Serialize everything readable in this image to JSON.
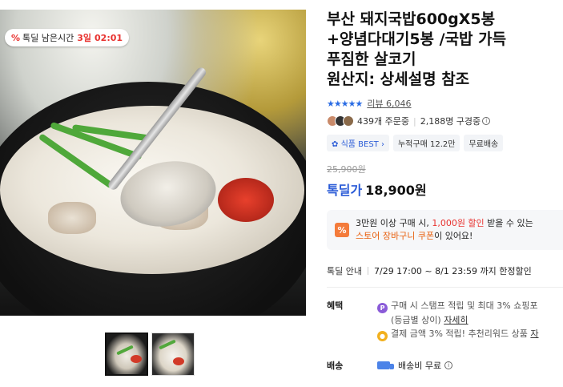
{
  "badge": {
    "icon": "%",
    "label": "톡딜 남은시간",
    "days": "3일",
    "time": "02:01"
  },
  "product": {
    "title": "부산 돼지국밥600gX5봉\n+양념다대기5봉 /국밥 가득\n푸짐한 살코기",
    "origin": "원산지: 상세설명 참조"
  },
  "rating": {
    "stars": "★★★★★",
    "review_label": "리뷰 6,046"
  },
  "social": {
    "orders": "439개 주문중",
    "watching": "2,188명 구경중"
  },
  "chips": [
    "식품 BEST",
    "누적구매 12.2만",
    "무료배송"
  ],
  "chip_best_icon": "✿",
  "price": {
    "original": "25,900원",
    "deal_label": "톡딜가",
    "current": "18,900원"
  },
  "coupon": {
    "icon": "%",
    "line1_a": "3만원 이상 구매 시, ",
    "line1_b": "1,000원 할인",
    "line1_c": " 받을 수 있는",
    "line2_a": "스토어 장바구니 쿠폰",
    "line2_b": "이 있어요!"
  },
  "deal_info": {
    "label": "톡딜 안내",
    "period": "7/29 17:00 ~ 8/1 23:59 까지 한정할인"
  },
  "benefit": {
    "label": "혜택",
    "line1": "구매 시 스탬프 적립 및 최대 3% 쇼핑포",
    "line2_a": "(등급별 상이)",
    "line2_link": "자세히",
    "line3": "결제 금액 3% 적립! 추천리워드 상품",
    "line3_tail": "자"
  },
  "shipping": {
    "label": "배송",
    "value": "배송비 무료"
  },
  "colors": {
    "accent_blue": "#2a5bd7",
    "red": "#e8322f",
    "orange": "#e8600f"
  }
}
